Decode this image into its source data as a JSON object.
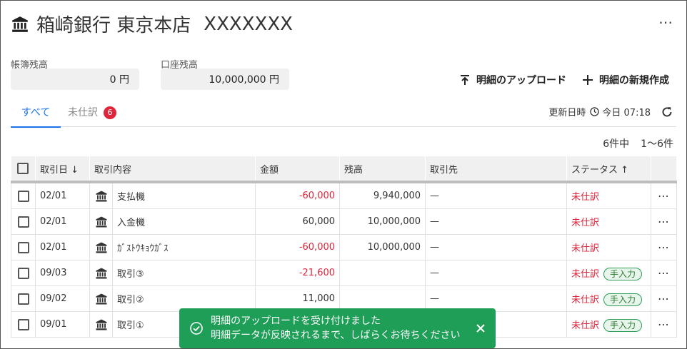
{
  "header": {
    "bank_name": "箱崎銀行 東京本店",
    "account": "XXXXXXX",
    "menu": "⋯"
  },
  "balances": {
    "book_label": "帳簿残高",
    "book_value": "0 円",
    "account_label": "口座残高",
    "account_value": "10,000,000 円"
  },
  "actions": {
    "upload": "明細のアップロード",
    "create": "明細の新規作成"
  },
  "tabs": {
    "all": "すべて",
    "pending": "未仕訳",
    "pending_count": "6"
  },
  "updated": {
    "label": "更新日時",
    "time": "今日 07:18"
  },
  "count": {
    "total": "6件中",
    "range": "1〜6件"
  },
  "table": {
    "headers": {
      "date": "取引日 ↓",
      "description": "取引内容",
      "amount": "金額",
      "balance": "残高",
      "partner": "取引先",
      "status": "ステータス ↑"
    },
    "rows": [
      {
        "date": "02/01",
        "desc": "支払機",
        "amount": "-60,000",
        "balance": "9,940,000",
        "partner": "—",
        "status": "未仕訳",
        "tag": "",
        "menu": "⋯"
      },
      {
        "date": "02/01",
        "desc": "入金機",
        "amount": "60,000",
        "balance": "10,000,000",
        "partner": "—",
        "status": "未仕訳",
        "tag": "",
        "menu": "⋯"
      },
      {
        "date": "02/01",
        "desc": "ｶﾞｽﾄｳｷｮｳｶﾞｽ",
        "amount": "-60,000",
        "balance": "10,000,000",
        "partner": "—",
        "status": "未仕訳",
        "tag": "",
        "menu": "⋯"
      },
      {
        "date": "09/03",
        "desc": "取引③",
        "amount": "-21,600",
        "balance": "",
        "partner": "—",
        "status": "未仕訳",
        "tag": "手入力",
        "menu": "⋯"
      },
      {
        "date": "09/02",
        "desc": "取引②",
        "amount": "11,000",
        "balance": "",
        "partner": "—",
        "status": "未仕訳",
        "tag": "手入力",
        "menu": "⋯"
      },
      {
        "date": "09/01",
        "desc": "取引①",
        "amount": "",
        "balance": "",
        "partner": "",
        "status": "未仕訳",
        "tag": "手入力",
        "menu": "⋯"
      }
    ]
  },
  "toast": {
    "line1": "明細のアップロードを受け付けました",
    "line2": "明細データが反映されるまで、しばらくお待ちください"
  },
  "colors": {
    "accent": "#1a73e8",
    "negative": "#e0243a",
    "toast": "#1e9e57"
  }
}
